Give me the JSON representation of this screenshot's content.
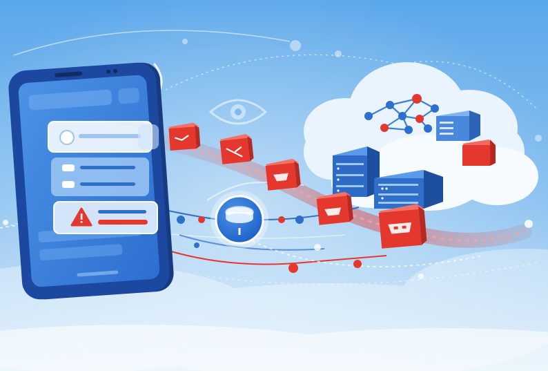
{
  "colors": {
    "background_top": "#4a9be4",
    "background_bottom": "#cfe6f8",
    "phone_body": "#1d3f8a",
    "phone_screen": "#3f86df",
    "alert_red": "#e4382f",
    "cloud_white": "#f4f9ff",
    "server_blue": "#2f6fc9",
    "node_blue": "#2b6fd1"
  },
  "icons": {
    "phone": "smartphone-icon",
    "eye": "eye-icon",
    "warning": "warning-triangle-icon",
    "wireless": "wireless-signal-icon",
    "data_packet": "data-packet-icon",
    "hub": "network-hub-icon",
    "cloud": "cloud-icon",
    "server": "server-rack-icon",
    "network_graph": "network-graph-icon"
  },
  "data_packet_count": 5
}
